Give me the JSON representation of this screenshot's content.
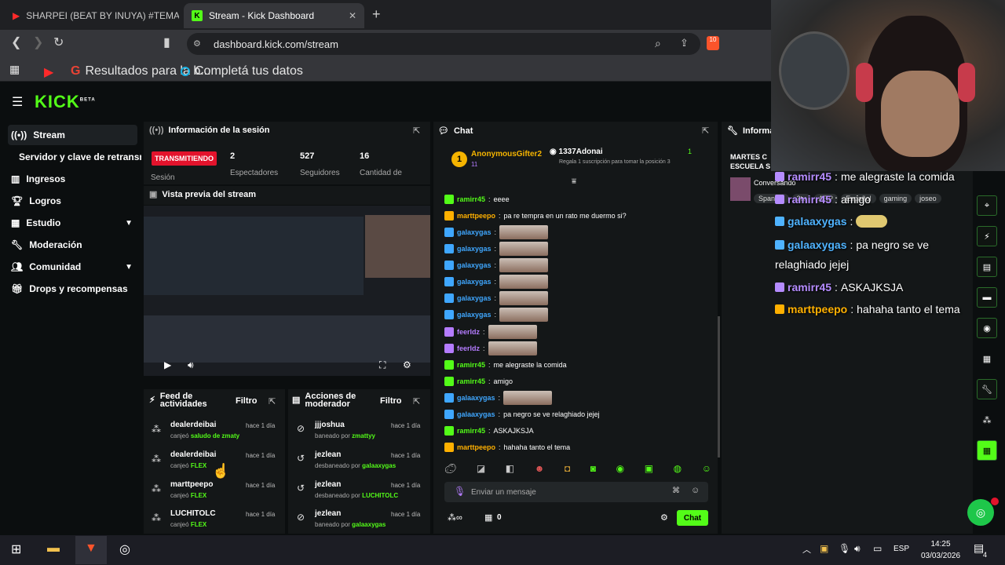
{
  "browser": {
    "tabs": [
      {
        "title": "SHARPEI (BEAT BY INUYA) #TEMA"
      },
      {
        "title": "Stream - Kick Dashboard"
      }
    ],
    "url": "dashboard.kick.com/stream",
    "bookmarks": [
      "Resultados para la b...",
      "Completá tus datos"
    ],
    "extension_count": "10"
  },
  "kick": {
    "logo": "KICK",
    "logo_tag": "BETA"
  },
  "sidebar": {
    "items": [
      {
        "label": "Stream",
        "icon": "stream-icon"
      },
      {
        "label": "Servidor y clave de retransmisión",
        "icon": ""
      },
      {
        "label": "Ingresos",
        "icon": "chart-icon"
      },
      {
        "label": "Logros",
        "icon": "trophy-icon"
      },
      {
        "label": "Estudio",
        "icon": "grid-icon"
      },
      {
        "label": "Moderación",
        "icon": "wrench-icon"
      },
      {
        "label": "Comunidad",
        "icon": "people-icon"
      },
      {
        "label": "Drops y recompensas",
        "icon": "gift-icon"
      }
    ]
  },
  "session": {
    "title": "Información de la sesión",
    "status": "TRANSMITIENDO",
    "status_label": "Sesión",
    "stats": [
      {
        "value": "2",
        "label": "Espectadores"
      },
      {
        "value": "527",
        "label": "Seguidores"
      },
      {
        "value": "16",
        "label": "Cantidad de"
      }
    ]
  },
  "preview": {
    "title": "Vista previa del stream"
  },
  "feed": {
    "title": "Feed de actividades",
    "filter": "Filtro",
    "rows": [
      {
        "name": "dealerdeibai",
        "verb": "canjeó",
        "item": "saludo de zmaty",
        "time": "hace 1 día"
      },
      {
        "name": "dealerdeibai",
        "verb": "canjeó",
        "item": "FLEX",
        "time": "hace 1 día"
      },
      {
        "name": "marttpeepo",
        "verb": "canjeó",
        "item": "FLEX",
        "time": "hace 1 día"
      },
      {
        "name": "LUCHITOLC",
        "verb": "canjeó",
        "item": "FLEX",
        "time": "hace 1 día"
      }
    ]
  },
  "modactions": {
    "title": "Acciones de moderador",
    "filter": "Filtro",
    "rows": [
      {
        "name": "jjjoshua",
        "verb": "baneado por",
        "by": "zmattyy",
        "time": "hace 1 día"
      },
      {
        "name": "jezlean",
        "verb": "desbaneado por",
        "by": "galaaxygas",
        "time": "hace 1 día"
      },
      {
        "name": "jezlean",
        "verb": "desbaneado por",
        "by": "LUCHITOLC",
        "time": "hace 1 día"
      },
      {
        "name": "jezlean",
        "verb": "baneado por",
        "by": "galaaxygas",
        "time": "hace 1 día"
      }
    ]
  },
  "chat": {
    "title": "Chat",
    "gifter": {
      "name": "AnonymousGifter2",
      "count": "11"
    },
    "gifter2": {
      "name": "1337Adonai",
      "count": "1",
      "text": "Regala 1 suscripción para tomar la posición 3"
    },
    "messages": [
      {
        "user": "ramirr45",
        "text": "eeee",
        "color": "#53fc18"
      },
      {
        "user": "marttpeepo",
        "text": "pa re tempra en un rato me duermo si?",
        "color": "#ffb000"
      },
      {
        "user": "galaxygas",
        "text": "",
        "color": "#3fa7ff"
      },
      {
        "user": "galaxygas",
        "text": "",
        "color": "#3fa7ff"
      },
      {
        "user": "galaxygas",
        "text": "",
        "color": "#3fa7ff"
      },
      {
        "user": "galaxygas",
        "text": "",
        "color": "#3fa7ff"
      },
      {
        "user": "galaxygas",
        "text": "",
        "color": "#3fa7ff"
      },
      {
        "user": "galaxygas",
        "text": "",
        "color": "#3fa7ff"
      },
      {
        "user": "feerldz",
        "text": "",
        "color": "#b57cff"
      },
      {
        "user": "feerldz",
        "text": "",
        "color": "#b57cff"
      },
      {
        "user": "ramirr45",
        "text": "me alegraste la comida",
        "color": "#53fc18"
      },
      {
        "user": "ramirr45",
        "text": "amigo",
        "color": "#53fc18"
      },
      {
        "user": "galaaxygas",
        "text": "",
        "color": "#3fa7ff"
      },
      {
        "user": "galaaxygas",
        "text": "pa negro se ve relaghiado jejej",
        "color": "#3fa7ff"
      },
      {
        "user": "ramirr45",
        "text": "ASKAJKSJA",
        "color": "#53fc18"
      },
      {
        "user": "marttpeepo",
        "text": "hahaha tanto el tema",
        "color": "#ffb000"
      }
    ],
    "input_placeholder": "Enviar un mensaje",
    "points": "0",
    "send": "Chat"
  },
  "info_panel": {
    "title": "Informac",
    "stream_title": "MARTES C ESCUELA S",
    "category": "Conversando",
    "tags": [
      "Spanish",
      "2tv",
      "ARP",
      "Español",
      "gaming",
      "joseo"
    ]
  },
  "overlay": {
    "messages": [
      {
        "user": "ramirr45",
        "text": "me alegraste la comida",
        "color": "#b58cff"
      },
      {
        "user": "ramirr45",
        "text": "amigo",
        "color": "#b58cff"
      },
      {
        "user": "galaaxygas",
        "text": "",
        "color": "#4fb3ff"
      },
      {
        "user": "galaaxygas",
        "text": "pa negro se ve",
        "color": "#4fb3ff"
      },
      {
        "user": "",
        "text": "relaghiado jejej",
        "color": "#ffffff"
      },
      {
        "user": "ramirr45",
        "text": "ASKAJKSJA",
        "color": "#b58cff"
      },
      {
        "user": "marttpeepo",
        "text": "hahaha tanto el tema",
        "color": "#ffb000"
      }
    ]
  },
  "taskbar": {
    "lang": "ESP",
    "time": "14:25",
    "date": "03/03/2026",
    "notif": "4"
  },
  "colors": {
    "accent": "#53fc18",
    "live": "#e3132c"
  }
}
